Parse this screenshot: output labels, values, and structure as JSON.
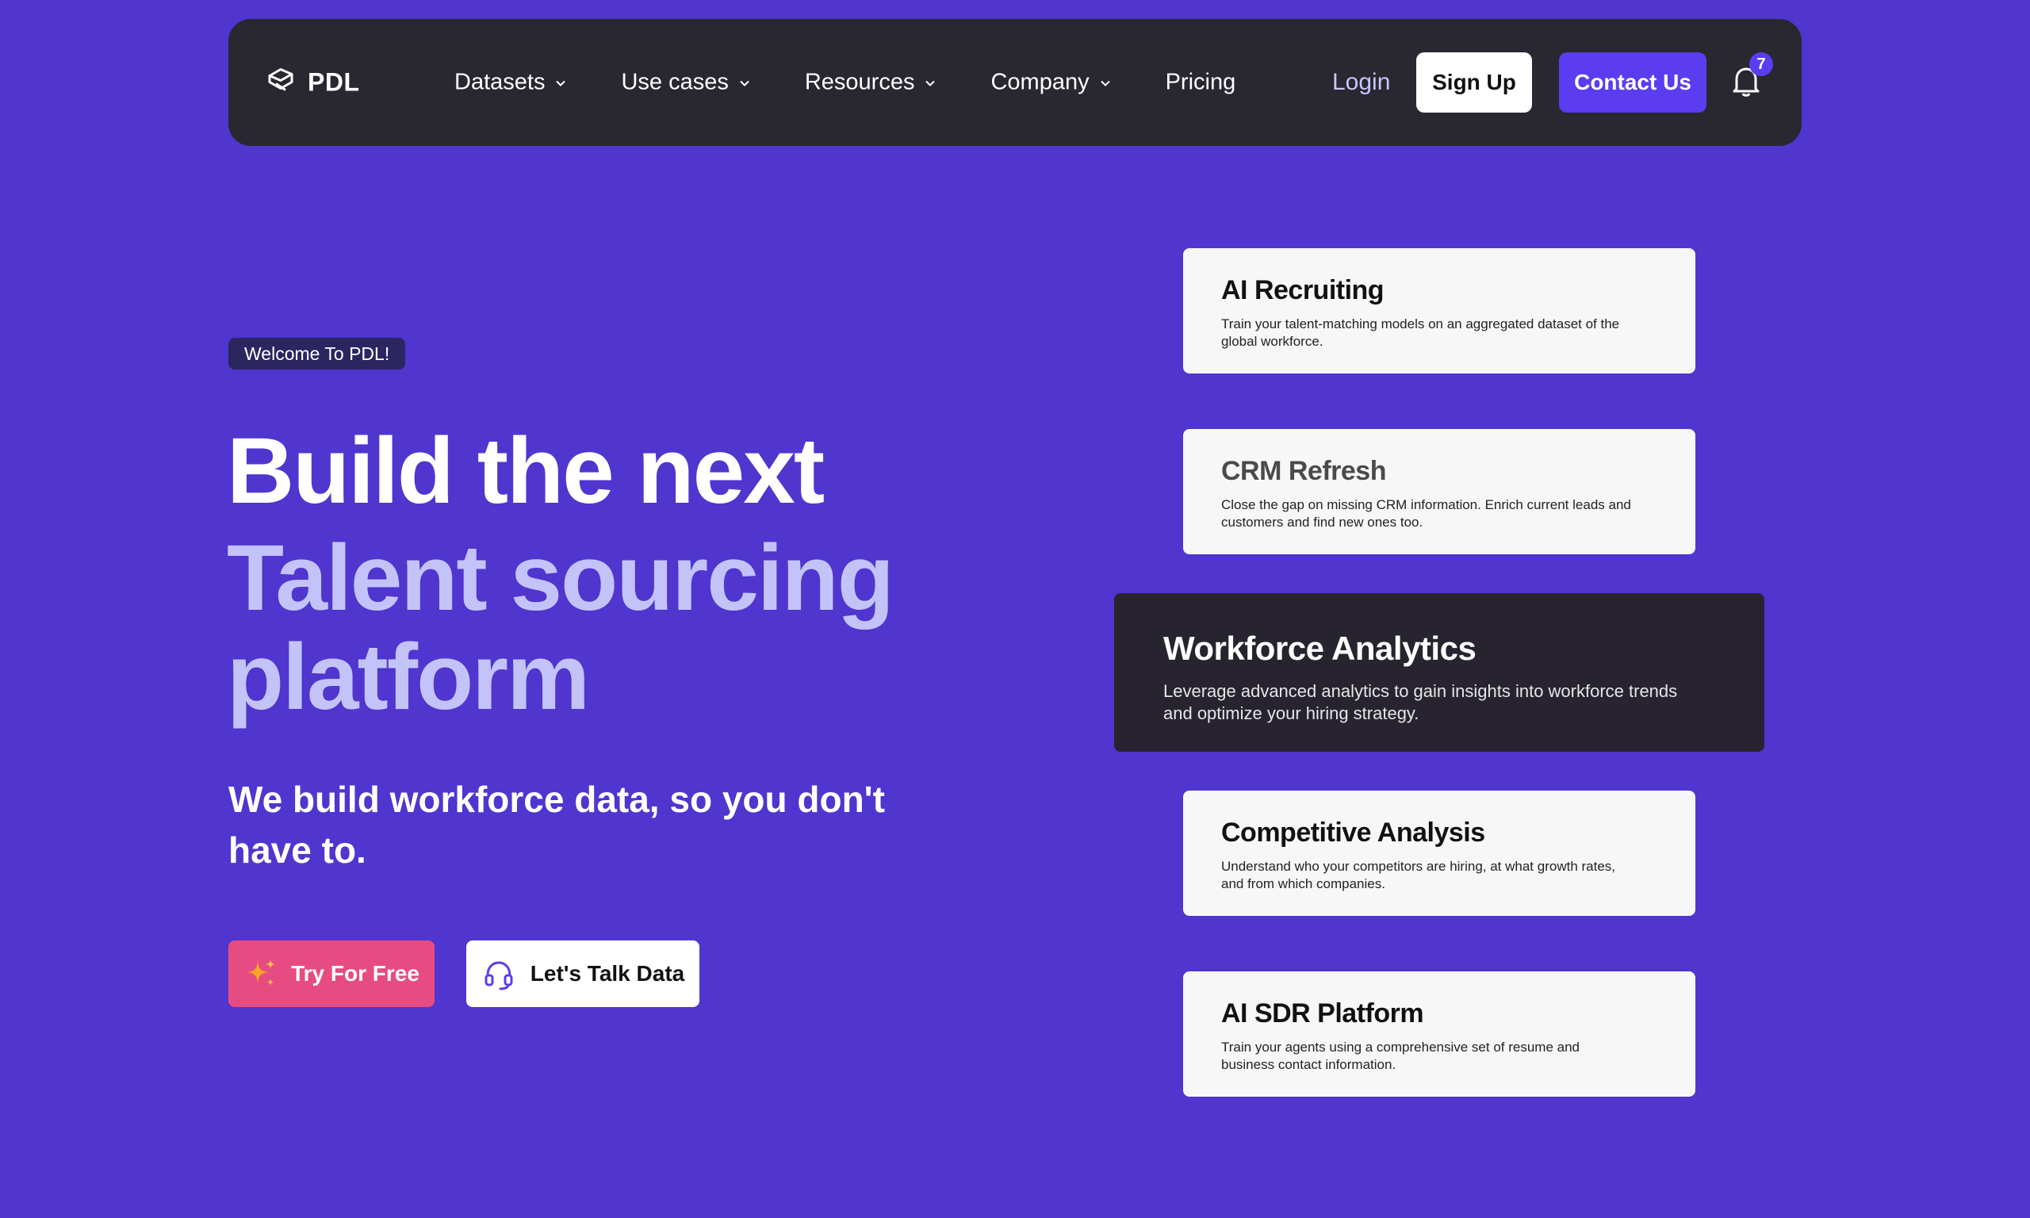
{
  "colors": {
    "background": "#5035CF",
    "nav": "#292730",
    "accent": "#5B3CF0",
    "headline_light": "#C3C3FA",
    "try_button": "#E64C82",
    "active_card": "#28242F"
  },
  "nav": {
    "logo_icon": "pdl-logo-icon",
    "logo_text": "PDL",
    "menu": [
      {
        "label": "Datasets",
        "has_dropdown": true
      },
      {
        "label": "Use cases",
        "has_dropdown": true
      },
      {
        "label": "Resources",
        "has_dropdown": true
      },
      {
        "label": "Company",
        "has_dropdown": true
      },
      {
        "label": "Pricing",
        "has_dropdown": false
      }
    ],
    "login_label": "Login",
    "signup_label": "Sign Up",
    "contact_label": "Contact Us",
    "notification_icon": "bell-icon",
    "notification_count": "7"
  },
  "hero": {
    "welcome_badge": "Welcome To PDL!",
    "headline_line1": "Build the next",
    "headline_line2": "Talent sourcing",
    "headline_line3": "platform",
    "subtitle": "We build workforce data, so you don't have to.",
    "try_button_label": "Try For Free",
    "try_button_icon": "sparkles-icon",
    "talk_button_label": "Let's Talk Data",
    "talk_button_icon": "headset-icon"
  },
  "use_cases": [
    {
      "title": "AI Recruiting",
      "description": "Train your talent-matching models on an aggregated dataset of the global workforce."
    },
    {
      "title": "CRM Refresh",
      "description": "Close the gap on missing CRM information. Enrich current leads and customers and find new ones too."
    },
    {
      "title": "Workforce Analytics",
      "description": "Leverage advanced analytics to gain insights into workforce trends and optimize your hiring strategy.",
      "active": true
    },
    {
      "title": "Competitive Analysis",
      "description": "Understand who your competitors are hiring, at what growth rates, and from which companies."
    },
    {
      "title": "AI SDR Platform",
      "description": "Train your agents using a comprehensive set of resume and business contact information."
    }
  ]
}
